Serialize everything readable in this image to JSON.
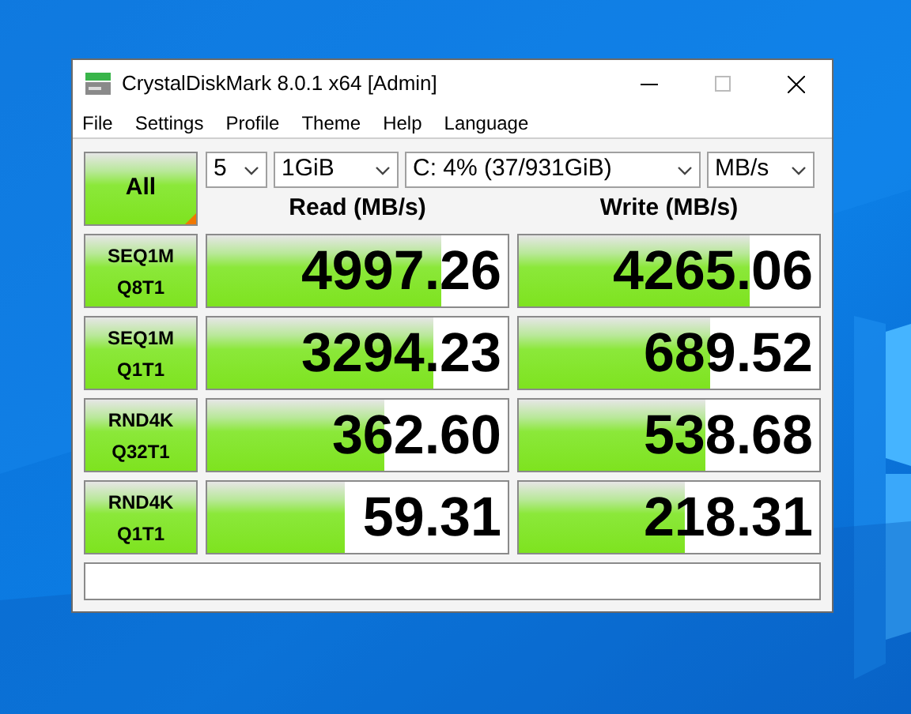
{
  "window": {
    "title": "CrystalDiskMark 8.0.1 x64 [Admin]"
  },
  "menu": [
    "File",
    "Settings",
    "Profile",
    "Theme",
    "Help",
    "Language"
  ],
  "controls": {
    "all_button": "All",
    "count": "5",
    "size": "1GiB",
    "drive": "C: 4% (37/931GiB)",
    "unit": "MB/s"
  },
  "headers": [
    "Read (MB/s)",
    "Write (MB/s)"
  ],
  "rows": [
    {
      "test": "SEQ1M",
      "params": "Q8T1",
      "read": {
        "value": "4997.26",
        "level": 0.78
      },
      "write": {
        "value": "4265.06",
        "level": 0.77
      }
    },
    {
      "test": "SEQ1M",
      "params": "Q1T1",
      "read": {
        "value": "3294.23",
        "level": 0.75
      },
      "write": {
        "value": "689.52",
        "level": 0.635
      }
    },
    {
      "test": "RND4K",
      "params": "Q32T1",
      "read": {
        "value": "362.60",
        "level": 0.59
      },
      "write": {
        "value": "538.68",
        "level": 0.62
      }
    },
    {
      "test": "RND4K",
      "params": "Q1T1",
      "read": {
        "value": "59.31",
        "level": 0.46
      },
      "write": {
        "value": "218.31",
        "level": 0.55
      }
    }
  ]
}
